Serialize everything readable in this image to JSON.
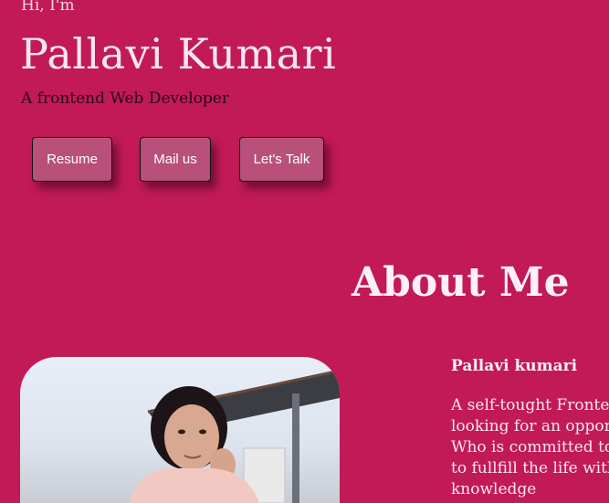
{
  "hero": {
    "greeting": "Hi, I'm",
    "name": "Pallavi Kumari",
    "tagline": "A frontend Web Developer"
  },
  "buttons": {
    "resume": "Resume",
    "mail": "Mail us",
    "talk": "Let's Talk"
  },
  "about": {
    "title": "About Me",
    "name": "Pallavi kumari",
    "lines": [
      "A self-tought Fronter",
      "looking for an oppor",
      "Who is committed to",
      "to fullfill the life with",
      "knowledge"
    ]
  },
  "colors": {
    "background": "#c11a57",
    "button": "#b85079"
  }
}
